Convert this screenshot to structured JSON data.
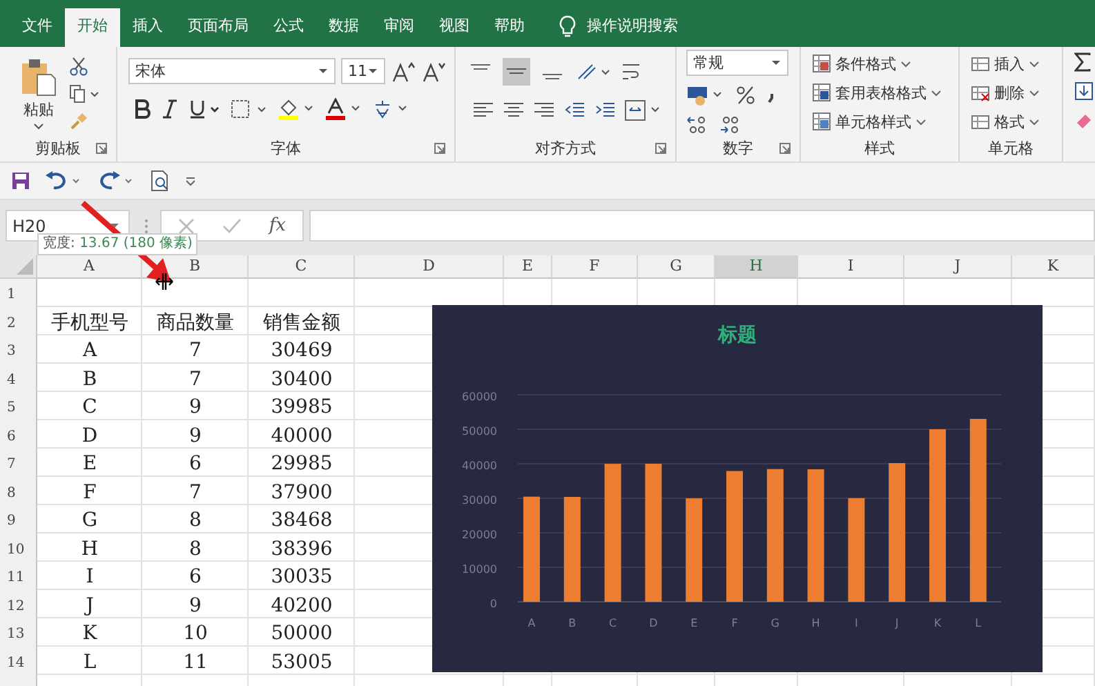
{
  "ribbon_tabs": [
    {
      "label": "文件",
      "selected": false
    },
    {
      "label": "开始",
      "selected": true
    },
    {
      "label": "插入",
      "selected": false
    },
    {
      "label": "页面布局",
      "selected": false
    },
    {
      "label": "公式",
      "selected": false
    },
    {
      "label": "数据",
      "selected": false
    },
    {
      "label": "审阅",
      "selected": false
    },
    {
      "label": "视图",
      "selected": false
    },
    {
      "label": "帮助",
      "selected": false
    }
  ],
  "tell_me": "操作说明搜索",
  "clipboard": {
    "paste": "粘贴",
    "label": "剪贴板"
  },
  "font": {
    "name": "宋体",
    "size": "11",
    "label": "字体"
  },
  "alignment": {
    "label": "对齐方式"
  },
  "number": {
    "format": "常规",
    "label": "数字"
  },
  "styles": {
    "items": [
      "条件格式",
      "套用表格格式",
      "单元格样式"
    ],
    "label": "样式"
  },
  "cells": {
    "items": [
      "插入",
      "删除",
      "格式"
    ],
    "label": "单元格"
  },
  "formula_bar": {
    "name_box": "H20",
    "function_button": "fx"
  },
  "tooltip": {
    "label": "宽度:",
    "value": "13.67 (180 像素)"
  },
  "sheet": {
    "columns": [
      {
        "label": "A",
        "selected": false
      },
      {
        "label": "B",
        "selected": false
      },
      {
        "label": "C",
        "selected": false
      },
      {
        "label": "D",
        "selected": false
      },
      {
        "label": "E",
        "selected": false
      },
      {
        "label": "F",
        "selected": false
      },
      {
        "label": "G",
        "selected": false
      },
      {
        "label": "H",
        "selected": true
      },
      {
        "label": "I",
        "selected": false
      },
      {
        "label": "J",
        "selected": false
      },
      {
        "label": "K",
        "selected": false
      }
    ],
    "rows": [
      {
        "number": "1"
      },
      {
        "number": "2",
        "cells": [
          "手机型号",
          "商品数量",
          "销售金额"
        ]
      },
      {
        "number": "3",
        "cells": [
          "A",
          "7",
          "30469"
        ]
      },
      {
        "number": "4",
        "cells": [
          "B",
          "7",
          "30400"
        ]
      },
      {
        "number": "5",
        "cells": [
          "C",
          "9",
          "39985"
        ]
      },
      {
        "number": "6",
        "cells": [
          "D",
          "9",
          "40000"
        ]
      },
      {
        "number": "7",
        "cells": [
          "E",
          "6",
          "29985"
        ]
      },
      {
        "number": "8",
        "cells": [
          "F",
          "7",
          "37900"
        ]
      },
      {
        "number": "9",
        "cells": [
          "G",
          "8",
          "38468"
        ]
      },
      {
        "number": "10",
        "cells": [
          "H",
          "8",
          "38396"
        ]
      },
      {
        "number": "11",
        "cells": [
          "I",
          "6",
          "30035"
        ]
      },
      {
        "number": "12",
        "cells": [
          "J",
          "9",
          "40200"
        ]
      },
      {
        "number": "13",
        "cells": [
          "K",
          "10",
          "50000"
        ]
      },
      {
        "number": "14",
        "cells": [
          "L",
          "11",
          "53005"
        ]
      }
    ]
  },
  "chart_data": {
    "type": "bar",
    "title": "标题",
    "categories": [
      "A",
      "B",
      "C",
      "D",
      "E",
      "F",
      "G",
      "H",
      "I",
      "J",
      "K",
      "L"
    ],
    "series": [
      {
        "color": "#ed7d31",
        "values": [
          30469,
          30400,
          39985,
          40000,
          29985,
          37900,
          38468,
          38396,
          30035,
          40200,
          50000,
          53005
        ]
      }
    ],
    "ylim": [
      0,
      60000
    ],
    "grid": true,
    "yticks": [
      0,
      10000,
      20000,
      30000,
      40000,
      50000,
      60000
    ]
  }
}
